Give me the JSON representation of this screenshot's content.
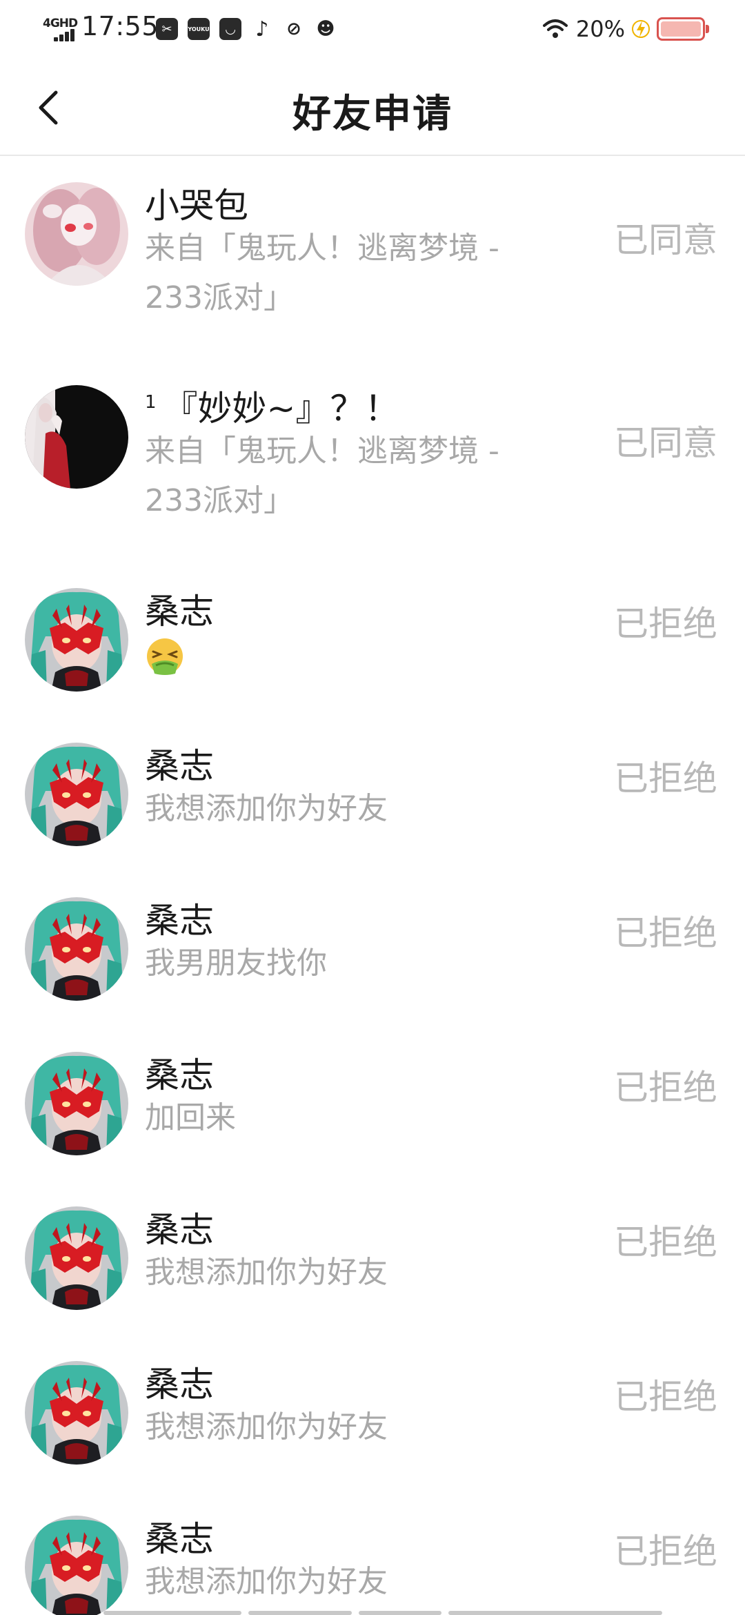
{
  "status_bar": {
    "network": "4GHD",
    "time": "17:55",
    "apps": [
      "scissors-app-icon",
      "youku-app-icon",
      "bag-app-icon",
      "tiktok-app-icon",
      "leaf-app-icon",
      "cat-app-icon"
    ],
    "youku_label": "YOUKU",
    "battery_percent": "20%",
    "battery_level": 0.2,
    "battery_color": "#d9534f"
  },
  "header": {
    "title": "好友申请",
    "back_icon": "chevron-left-icon"
  },
  "requests": [
    {
      "name": "小哭包",
      "name_prefix": "",
      "message": "来自「鬼玩人！逃离梦境 - 233派对」",
      "status": "已同意",
      "avatar": "pink-girl-avatar"
    },
    {
      "name": "『妙妙~』？！",
      "name_prefix": "1",
      "message": "来自「鬼玩人！逃离梦境 - 233派对」",
      "status": "已同意",
      "avatar": "dark-hair-avatar"
    },
    {
      "name": "桑志",
      "name_prefix": "",
      "message": "",
      "message_emoji": "nauseated-face-emoji",
      "status": "已拒绝",
      "avatar": "red-mask-avatar"
    },
    {
      "name": "桑志",
      "name_prefix": "",
      "message": "我想添加你为好友",
      "status": "已拒绝",
      "avatar": "red-mask-avatar"
    },
    {
      "name": "桑志",
      "name_prefix": "",
      "message": "我男朋友找你",
      "status": "已拒绝",
      "avatar": "red-mask-avatar"
    },
    {
      "name": "桑志",
      "name_prefix": "",
      "message": "加回来",
      "status": "已拒绝",
      "avatar": "red-mask-avatar"
    },
    {
      "name": "桑志",
      "name_prefix": "",
      "message": "我想添加你为好友",
      "status": "已拒绝",
      "avatar": "red-mask-avatar"
    },
    {
      "name": "桑志",
      "name_prefix": "",
      "message": "我想添加你为好友",
      "status": "已拒绝",
      "avatar": "red-mask-avatar"
    },
    {
      "name": "桑志",
      "name_prefix": "",
      "message": "我想添加你为好友",
      "status": "已拒绝",
      "avatar": "red-mask-avatar"
    }
  ]
}
